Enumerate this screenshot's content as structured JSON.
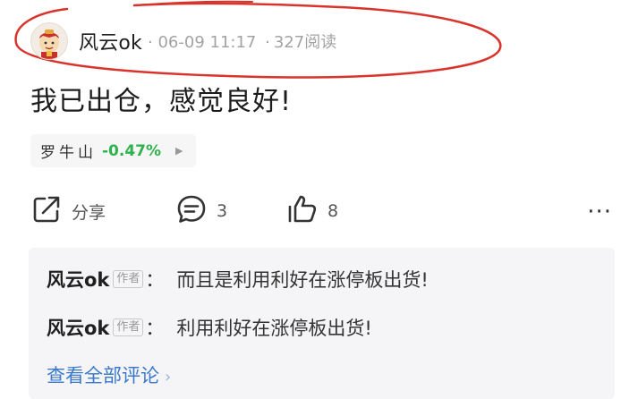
{
  "post": {
    "author": "风云ok",
    "date": "06-09 11:17",
    "separator": "·",
    "views": "327阅读",
    "text": "我已出仓，感觉良好!"
  },
  "stock_tag": {
    "name": "罗牛山",
    "change": "-0.47%",
    "change_color": "#2fb24d"
  },
  "actions": {
    "share_label": "分享",
    "comment_count": "3",
    "like_count": "8",
    "more_label": "···"
  },
  "comments": {
    "items": [
      {
        "author": "风云ok",
        "badge": "作者",
        "colon": "：",
        "text": "而且是利用利好在涨停板出货!"
      },
      {
        "author": "风云ok",
        "badge": "作者",
        "colon": "：",
        "text": "利用利好在涨停板出货!"
      }
    ],
    "view_all": "查看全部评论",
    "view_all_chevron": "›"
  },
  "annotation_color": "#d9342b",
  "icons": {
    "avatar": "avatar-icon",
    "share": "share-icon",
    "comment": "comment-bubble-icon",
    "like": "thumbs-up-icon",
    "stock_arrow": "triangle-right-icon"
  }
}
